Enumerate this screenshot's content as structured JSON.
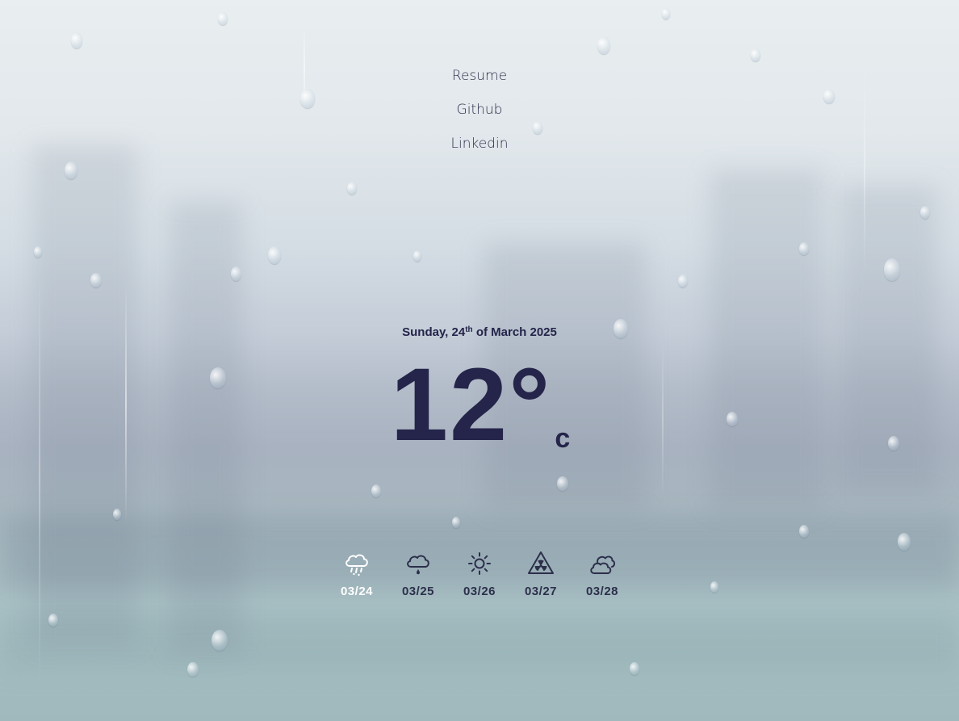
{
  "nav": {
    "links": [
      "Resume",
      "Github",
      "Linkedin"
    ]
  },
  "date": {
    "prefix": "Sunday, 24",
    "ordinal": "th",
    "suffix": " of March 2025"
  },
  "weather": {
    "temperature": "12°",
    "unit": "c"
  },
  "forecast": [
    {
      "label": "03/24",
      "icon": "cloud-rain-icon",
      "active": true
    },
    {
      "label": "03/25",
      "icon": "cloud-drizzle-icon",
      "active": false
    },
    {
      "label": "03/26",
      "icon": "sun-icon",
      "active": false
    },
    {
      "label": "03/27",
      "icon": "radiation-warning-icon",
      "active": false
    },
    {
      "label": "03/28",
      "icon": "clouds-icon",
      "active": false
    }
  ],
  "colors": {
    "text": "#25244a",
    "active_day": "#ffffff"
  }
}
